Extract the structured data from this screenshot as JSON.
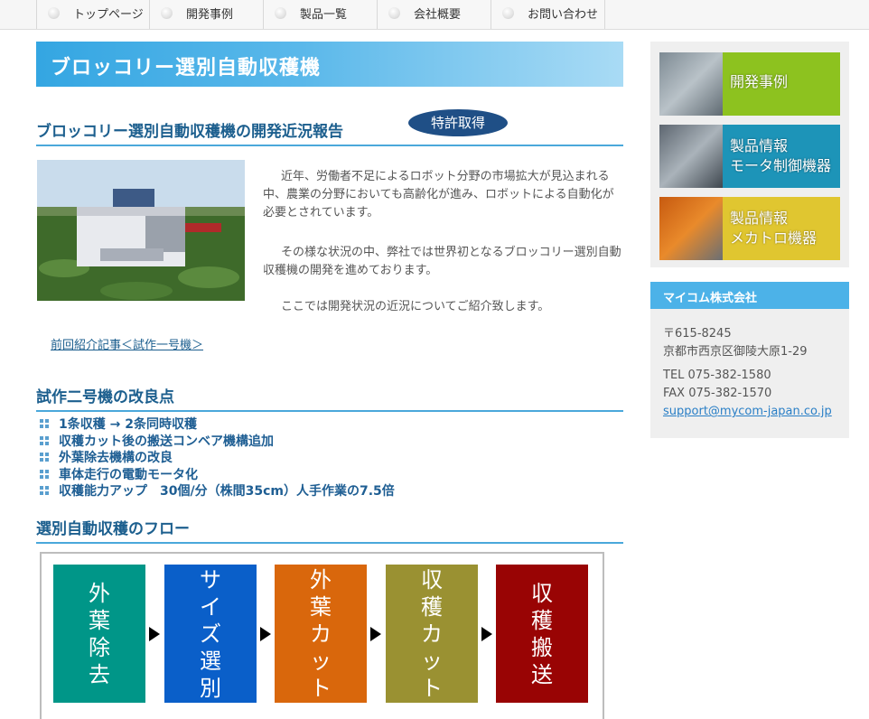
{
  "nav": {
    "items": [
      {
        "label": "トップページ"
      },
      {
        "label": "開発事例"
      },
      {
        "label": "製品一覧"
      },
      {
        "label": "会社概要"
      },
      {
        "label": "お問い合わせ"
      }
    ]
  },
  "page": {
    "title": "ブロッコリー選別自動収穫機"
  },
  "report": {
    "heading": "ブロッコリー選別自動収穫機の開発近況報告",
    "badge": "特許取得",
    "paragraphs": [
      "近年、労働者不足によるロボット分野の市場拡大が見込まれる中、農業の分野においても高齢化が進み、ロボットによる自動化が必要とされています。",
      "その様な状況の中、弊社では世界初となるブロッコリー選別自動収穫機の開発を進めております。",
      "ここでは開発状況の近況についてご紹介致します。"
    ],
    "prev_link": "前回紹介記事＜試作一号機＞"
  },
  "improvements": {
    "heading": "試作二号機の改良点",
    "items": [
      "1条収穫 → 2条同時収穫",
      "収穫カット後の搬送コンベア機構追加",
      "外葉除去機構の改良",
      "車体走行の電動モータ化",
      "収穫能力アップ　30個/分（株間35cm）人手作業の7.5倍"
    ]
  },
  "flow": {
    "heading": "選別自動収穫のフロー",
    "steps": [
      {
        "label": "外葉除去",
        "color": "#009688"
      },
      {
        "label": "サイズ選別",
        "color": "#0a5fc9"
      },
      {
        "label": "外葉カット",
        "color": "#d9670c"
      },
      {
        "label": "収穫カット",
        "color": "#9a9132"
      },
      {
        "label": "収穫搬送",
        "color": "#990404"
      }
    ]
  },
  "sidebar": {
    "buttons": [
      {
        "line1": "開発事例",
        "line2": "",
        "color": "#8dc21f"
      },
      {
        "line1": "製品情報",
        "line2": "モータ制御機器",
        "color": "#1d94b8"
      },
      {
        "line1": "製品情報",
        "line2": "メカトロ機器",
        "color": "#e0c630"
      }
    ],
    "company": {
      "name": "マイコム株式会社",
      "postal": "〒615-8245",
      "address": "京都市西京区御陵大原1-29",
      "tel": "TEL 075-382-1580",
      "fax": "FAX 075-382-1570",
      "email": "support@mycom-japan.co.jp"
    }
  }
}
